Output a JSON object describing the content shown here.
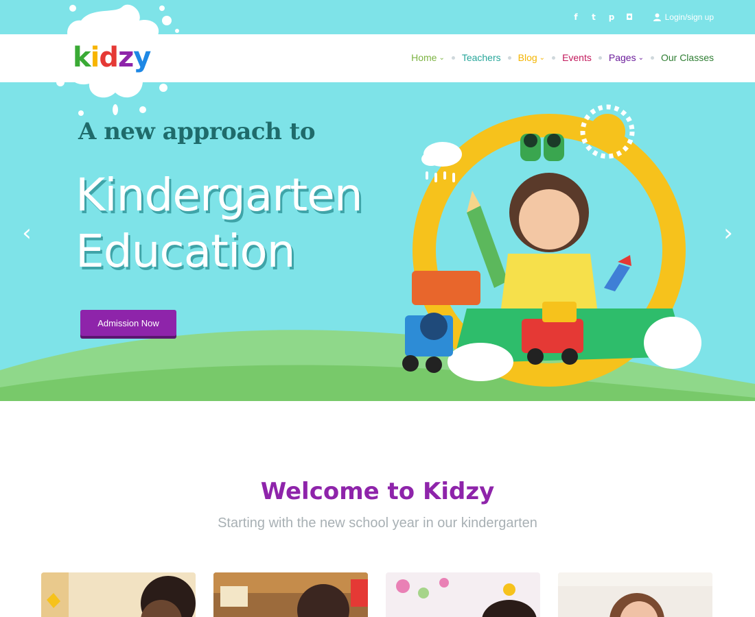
{
  "topbar": {
    "social": [
      {
        "name": "facebook-icon",
        "glyph": "f"
      },
      {
        "name": "twitter-icon",
        "glyph": "t"
      },
      {
        "name": "pinterest-icon",
        "glyph": "p"
      },
      {
        "name": "instagram-icon",
        "glyph": "◘"
      }
    ],
    "login_label": "Login/sign up"
  },
  "brand": {
    "letters": [
      {
        "ch": "k",
        "color": "#3aaa35"
      },
      {
        "ch": "i",
        "color": "#f7b500"
      },
      {
        "ch": "d",
        "color": "#e53935"
      },
      {
        "ch": "z",
        "color": "#8e24aa"
      },
      {
        "ch": "y",
        "color": "#1e88e5"
      }
    ]
  },
  "nav": {
    "items": [
      {
        "label": "Home",
        "color": "#7cb342",
        "dropdown": true
      },
      {
        "label": "Teachers",
        "color": "#26a69a",
        "dropdown": false
      },
      {
        "label": "Blog",
        "color": "#f4b400",
        "dropdown": true
      },
      {
        "label": "Events",
        "color": "#c2185b",
        "dropdown": false
      },
      {
        "label": "Pages",
        "color": "#6a1b9a",
        "dropdown": true
      },
      {
        "label": "Our Classes",
        "color": "#2e7d32",
        "dropdown": false
      }
    ]
  },
  "hero": {
    "kicker": "A new approach to",
    "title_line1": "Kindergarten",
    "title_line2": "Education",
    "cta_label": "Admission Now",
    "prev_arrow": "‹",
    "next_arrow": "›"
  },
  "welcome": {
    "title": "Welcome to Kidzy",
    "subtitle": "Starting with the new school year in our kindergarten"
  },
  "colors": {
    "sky": "#7ee3e8",
    "accent_purple": "#8e24aa",
    "grass": "#7cc96e"
  }
}
